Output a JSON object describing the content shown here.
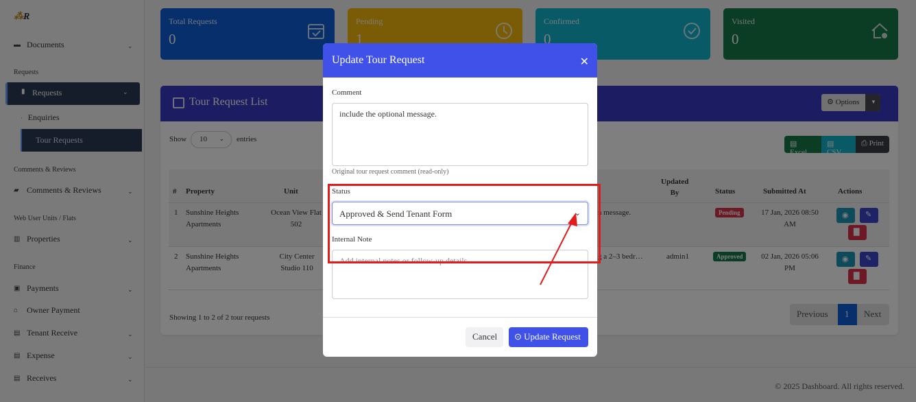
{
  "sidebar": {
    "logo": "R",
    "documents": "Documents",
    "sec_requests": "Requests",
    "requests": "Requests",
    "enquiries": "Enquiries",
    "tour_requests": "Tour Requests",
    "sec_comments": "Comments & Reviews",
    "comments": "Comments & Reviews",
    "sec_units": "Web User Units / Flats",
    "properties": "Properties",
    "sec_finance": "Finance",
    "payments": "Payments",
    "owner_payment": "Owner Payment",
    "tenant_receive": "Tenant Receive",
    "expense": "Expense",
    "receives": "Receives"
  },
  "cards": [
    {
      "title": "Total Requests",
      "value": "0",
      "color": "#0d5fd9",
      "icon": "calendar-check-icon"
    },
    {
      "title": "Pending",
      "value": "1",
      "color": "#f5b90c",
      "icon": "clock-icon"
    },
    {
      "title": "Confirmed",
      "value": "0",
      "color": "#12b4cf",
      "icon": "check-circle-icon"
    },
    {
      "title": "Visited",
      "value": "0",
      "color": "#157a46",
      "icon": "house-check-icon"
    }
  ],
  "panel": {
    "title": "Tour Request List",
    "options": "Options",
    "show": "Show",
    "entries_value": "10",
    "entries": "entries",
    "excel": "Excel",
    "csv": "CSV",
    "print": "Print",
    "columns": [
      "#",
      "Property",
      "Unit",
      "Updated By",
      "Status",
      "Submitted At",
      "Actions"
    ],
    "rows": [
      {
        "num": "1",
        "property": "Sunshine Heights Apartments",
        "unit": "Ocean View Flat 502",
        "comment": "n message.",
        "updated_by": "",
        "status": "Pending",
        "submitted": "17 Jan, 2026 08:50 AM"
      },
      {
        "num": "2",
        "property": "Sunshine Heights Apartments",
        "unit": "City Center Studio 110",
        "comment": "g a 2–3 bedr…",
        "updated_by": "admin1",
        "status": "Approved",
        "submitted": "02 Jan, 2026 05:06 PM"
      }
    ],
    "showing": "Showing 1 to 2 of 2 tour requests",
    "prev": "Previous",
    "page": "1",
    "next": "Next"
  },
  "footer": "© 2025 Dashboard. All rights reserved.",
  "modal": {
    "title": "Update Tour Request",
    "comment_label": "Comment",
    "comment_value": "include the optional message.",
    "comment_help": "Original tour request comment (read-only)",
    "status_label": "Status",
    "status_value": "Approved & Send Tenant Form",
    "note_label": "Internal Note",
    "note_placeholder": "Add internal notes or follow-up details...",
    "cancel": "Cancel",
    "update": "Update Request"
  }
}
